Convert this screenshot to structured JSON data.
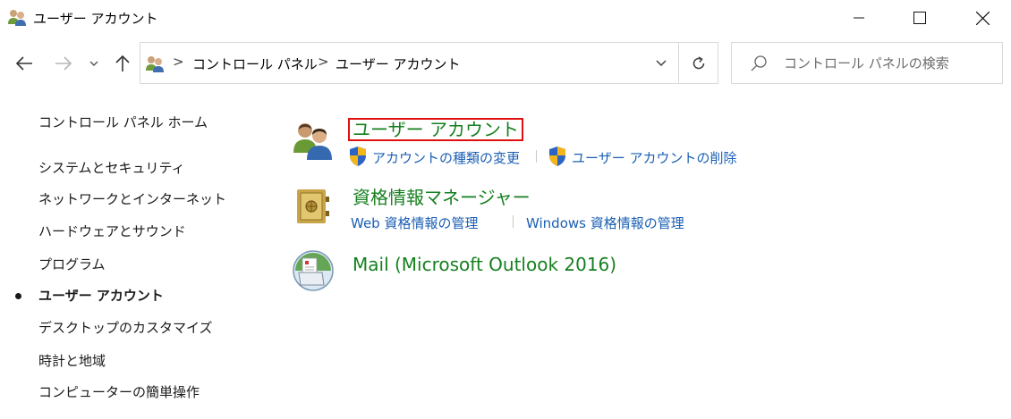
{
  "window": {
    "title": "ユーザー アカウント",
    "minimize_icon": "minimize-icon",
    "maximize_icon": "maximize-icon",
    "close_icon": "close-icon"
  },
  "navigation": {
    "back_icon": "arrow-left-icon",
    "forward_icon": "arrow-right-icon",
    "recent_icon": "chevron-down-icon",
    "up_icon": "arrow-up-icon"
  },
  "address": {
    "breadcrumbs": [
      "コントロール パネル",
      "ユーザー アカウント"
    ],
    "separator": ">",
    "dropdown_icon": "chevron-down-icon",
    "refresh_icon": "refresh-icon"
  },
  "search": {
    "placeholder": "コントロール パネルの検索",
    "value": ""
  },
  "sidebar": {
    "home": "コントロール パネル ホーム",
    "items": [
      {
        "label": "システムとセキュリティ",
        "active": false
      },
      {
        "label": "ネットワークとインターネット",
        "active": false
      },
      {
        "label": "ハードウェアとサウンド",
        "active": false
      },
      {
        "label": "プログラム",
        "active": false
      },
      {
        "label": "ユーザー アカウント",
        "active": true
      },
      {
        "label": "デスクトップのカスタマイズ",
        "active": false
      },
      {
        "label": "時計と地域",
        "active": false
      },
      {
        "label": "コンピューターの簡単操作",
        "active": false
      }
    ]
  },
  "categories": [
    {
      "title": "ユーザー アカウント",
      "icon": "user-accounts-icon",
      "links": [
        "アカウントの種類の変更",
        "ユーザー アカウントの削除"
      ]
    },
    {
      "title": "資格情報マネージャー",
      "icon": "credential-vault-icon",
      "links": [
        "Web 資格情報の管理",
        "Windows 資格情報の管理"
      ]
    },
    {
      "title": "Mail (Microsoft Outlook 2016)",
      "icon": "mail-icon",
      "links": []
    }
  ],
  "colors": {
    "category_title": "#16801f",
    "link": "#1b5fb4",
    "highlight_box": "#e01010"
  }
}
